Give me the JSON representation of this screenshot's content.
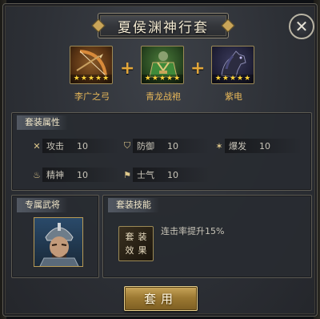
{
  "dialog": {
    "title": "夏侯渊神行套",
    "close_icon": "close-icon"
  },
  "set_items": [
    {
      "name": "李广之弓",
      "stars": 5,
      "icon": "bow-icon"
    },
    {
      "name": "青龙战袍",
      "stars": 5,
      "icon": "armor-icon"
    },
    {
      "name": "紫电",
      "stars": 5,
      "icon": "horse-icon"
    }
  ],
  "plus_symbol": "+",
  "attributes": {
    "header": "套装属性",
    "items": [
      {
        "label": "攻击",
        "value": "10",
        "icon": "attack-icon"
      },
      {
        "label": "防御",
        "value": "10",
        "icon": "defense-icon"
      },
      {
        "label": "爆发",
        "value": "10",
        "icon": "burst-icon"
      },
      {
        "label": "精神",
        "value": "10",
        "icon": "spirit-icon"
      },
      {
        "label": "士气",
        "value": "10",
        "icon": "morale-icon"
      }
    ]
  },
  "general": {
    "header": "专属武将",
    "portrait_icon": "general-portrait"
  },
  "skill": {
    "header": "套装技能",
    "icon_chars": [
      "套",
      "装",
      "效",
      "果"
    ],
    "description": "连击率提升15%"
  },
  "apply_button": {
    "label": "套用"
  },
  "colors": {
    "gold": "#e8b85a",
    "star": "#ffd43a",
    "panel": "#2d3036",
    "button": "#9d7a33"
  }
}
